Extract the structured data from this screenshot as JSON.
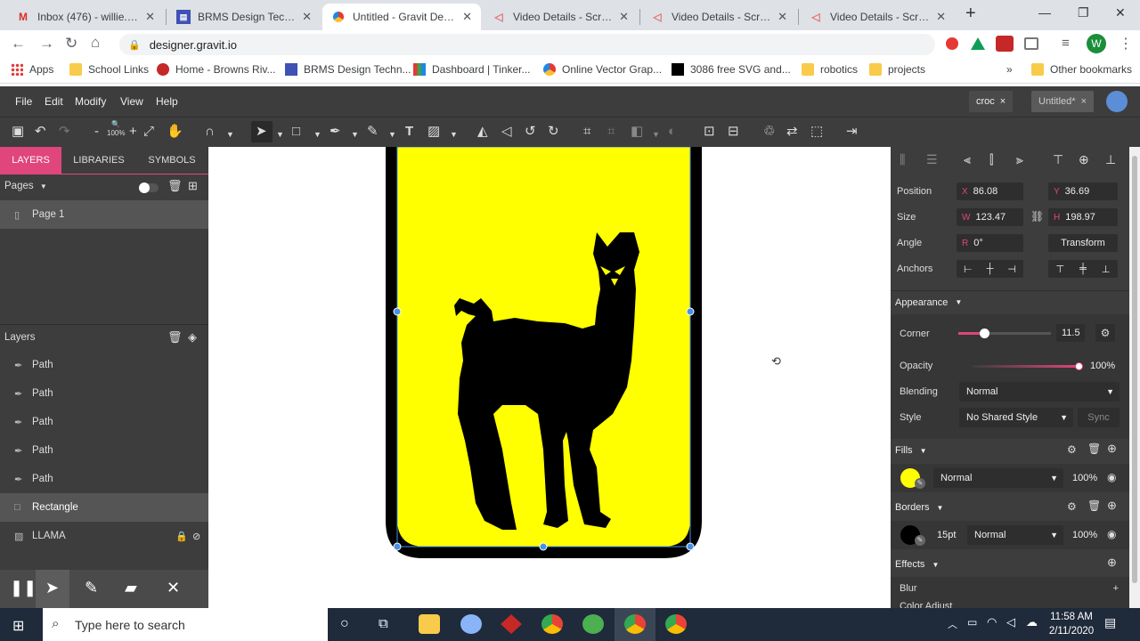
{
  "browser": {
    "tabs": [
      {
        "label": "Inbox (476) - willie.lee@",
        "icon": "gmail-icon"
      },
      {
        "label": "BRMS Design Technolo",
        "icon": "site-icon"
      },
      {
        "label": "Untitled - Gravit Design",
        "icon": "gravit-icon",
        "active": true
      },
      {
        "label": "Video Details - Screenc",
        "icon": "screencast-icon"
      },
      {
        "label": "Video Details - Screenc",
        "icon": "screencast-icon"
      },
      {
        "label": "Video Details - Screenc",
        "icon": "screencast-icon"
      }
    ],
    "new_tab": "+",
    "url": "designer.gravit.io",
    "profile_initial": "W",
    "bookmarks": [
      "Apps",
      "School Links",
      "Home - Browns Riv...",
      "BRMS Design Techn...",
      "Dashboard | Tinker...",
      "Online Vector Grap...",
      "3086 free SVG and...",
      "robotics",
      "projects"
    ],
    "more_bookmarks": "»",
    "other_bookmarks": "Other bookmarks"
  },
  "gravit": {
    "menu": [
      "File",
      "Edit",
      "Modify",
      "View",
      "Help"
    ],
    "doc_tabs": [
      {
        "label": "croc",
        "close": "×"
      },
      {
        "label": "Untitled*",
        "close": "×"
      }
    ],
    "zoom": "100%",
    "left_tabs": [
      "LAYERS",
      "LIBRARIES",
      "SYMBOLS"
    ],
    "pages_label": "Pages",
    "page_name": "Page 1",
    "layers_label": "Layers",
    "layers": [
      "Path",
      "Path",
      "Path",
      "Path",
      "Path",
      "Rectangle",
      "LLAMA"
    ],
    "position_label": "Position",
    "x_prefix": "X",
    "x": "86.08",
    "y_prefix": "Y",
    "y": "36.69",
    "size_label": "Size",
    "w_prefix": "W",
    "w": "123.47",
    "h_prefix": "H",
    "h": "198.97",
    "angle_label": "Angle",
    "r_prefix": "R",
    "angle": "0°",
    "transform_label": "Transform",
    "anchors_label": "Anchors",
    "appearance_label": "Appearance",
    "corner_label": "Corner",
    "corner_value": "11.5",
    "corner_level": 0.28,
    "opacity_label": "Opacity",
    "opacity_value": "100%",
    "opacity_level": 1.0,
    "blending_label": "Blending",
    "blending_value": "Normal",
    "style_label": "Style",
    "style_value": "No Shared Style",
    "sync_label": "Sync",
    "fills_label": "Fills",
    "fill_blend": "Normal",
    "fill_opacity": "100%",
    "fill_color": "#ffff00",
    "borders_label": "Borders",
    "border_width": "15pt",
    "border_blend": "Normal",
    "border_opacity": "100%",
    "border_color": "#000000",
    "effects_label": "Effects",
    "blur_label": "Blur",
    "color_adjust_label": "Color Adjust"
  },
  "taskbar": {
    "search_placeholder": "Type here to search",
    "time": "11:58 AM",
    "date": "2/11/2020"
  }
}
